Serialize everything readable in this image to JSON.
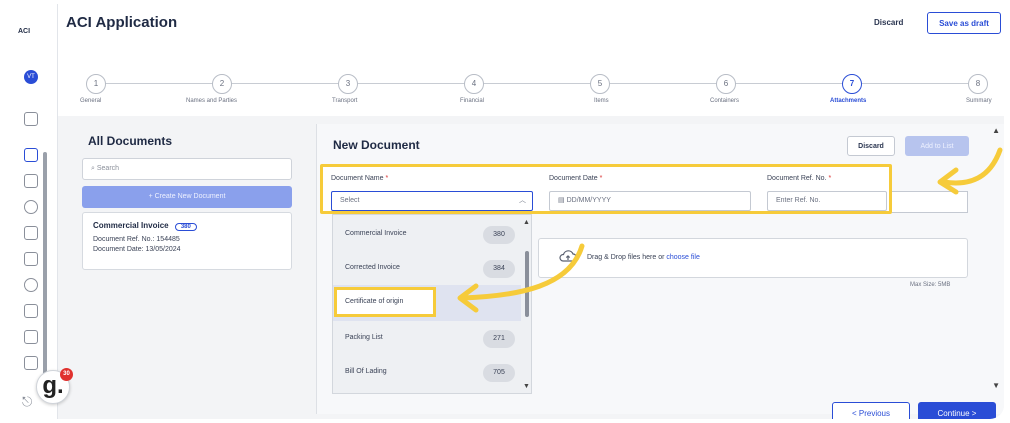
{
  "app": {
    "logo": "ACI",
    "avatar": "VT",
    "title": "ACI Application",
    "discard_label": "Discard",
    "save_draft_label": "Save as draft"
  },
  "stepper": {
    "steps": [
      {
        "num": "1",
        "label": "General"
      },
      {
        "num": "2",
        "label": "Names and Parties"
      },
      {
        "num": "3",
        "label": "Transport"
      },
      {
        "num": "4",
        "label": "Financial"
      },
      {
        "num": "5",
        "label": "Items"
      },
      {
        "num": "6",
        "label": "Containers"
      },
      {
        "num": "7",
        "label": "Attachments"
      },
      {
        "num": "8",
        "label": "Summary"
      }
    ],
    "active_index": 6
  },
  "all_documents": {
    "title": "All Documents",
    "search_placeholder": "Search",
    "create_label": "+ Create New Document",
    "card": {
      "title": "Commercial Invoice",
      "badge": "380",
      "ref": "Document Ref. No.: 154485",
      "date": "Document Date: 13/05/2024"
    }
  },
  "new_document": {
    "title": "New Document",
    "discard_label": "Discard",
    "add_label": "Add to List",
    "fields": {
      "name_label": "Document Name",
      "name_value": "Select",
      "date_label": "Document Date",
      "date_placeholder": "DD/MM/YYYY",
      "ref_label": "Document Ref. No.",
      "ref_placeholder": "Enter Ref. No.",
      "required_mark": "*"
    },
    "dropdown": [
      {
        "label": "Commercial Invoice",
        "count": "380"
      },
      {
        "label": "Corrected Invoice",
        "count": "384"
      },
      {
        "label": "Certificate of origin",
        "count": ""
      },
      {
        "label": "Packing List",
        "count": "271"
      },
      {
        "label": "Bill Of Lading",
        "count": "705"
      }
    ],
    "upload": {
      "text": "Drag & Drop files here or",
      "link": "choose file",
      "max_size": "Max Size: 5MB"
    }
  },
  "footer": {
    "previous_label": "<  Previous",
    "continue_label": "Continue  >"
  },
  "badge": {
    "letter": "g.",
    "count": "30"
  },
  "colors": {
    "accent": "#2a4dd6",
    "highlight": "#f6cb3a"
  }
}
